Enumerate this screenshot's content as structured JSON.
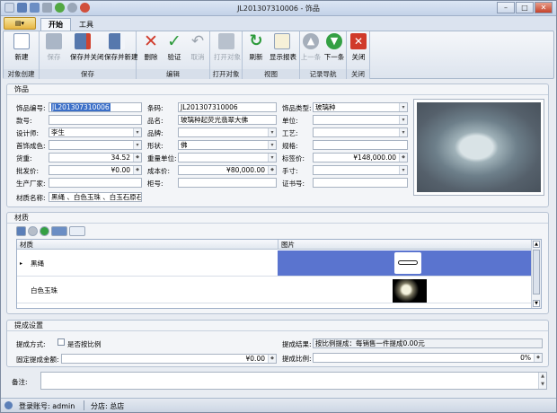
{
  "window": {
    "title": "JL201307310006 - 饰品"
  },
  "tabs": [
    {
      "label": "开始"
    },
    {
      "label": "工具"
    }
  ],
  "ribbon": {
    "groups": [
      {
        "label": "对象创建",
        "buttons": [
          {
            "label": "新建",
            "icon": "new-doc-icon"
          }
        ]
      },
      {
        "label": "保存",
        "buttons": [
          {
            "label": "保存",
            "icon": "save-icon"
          },
          {
            "label": "保存并关闭",
            "icon": "save-close-icon"
          },
          {
            "label": "保存并新建",
            "icon": "save-new-icon"
          }
        ]
      },
      {
        "label": "编辑",
        "buttons": [
          {
            "label": "删除",
            "icon": "delete-icon"
          },
          {
            "label": "验证",
            "icon": "check-icon"
          },
          {
            "label": "取消",
            "icon": "undo-icon"
          }
        ]
      },
      {
        "label": "打开对象",
        "buttons": [
          {
            "label": "打开对象",
            "icon": "open-object-icon"
          }
        ]
      },
      {
        "label": "视图",
        "buttons": [
          {
            "label": "刷新",
            "icon": "refresh-icon"
          },
          {
            "label": "显示报表",
            "icon": "report-icon"
          }
        ]
      },
      {
        "label": "记录导航",
        "buttons": [
          {
            "label": "上一条",
            "icon": "arrow-up-icon"
          },
          {
            "label": "下一条",
            "icon": "arrow-down-icon"
          }
        ]
      },
      {
        "label": "关闭",
        "buttons": [
          {
            "label": "关闭",
            "icon": "close-red-icon"
          }
        ]
      }
    ]
  },
  "jewelry": {
    "section_title": "饰品",
    "fields": {
      "item_no": {
        "label": "饰品编号:",
        "value": "JL201307310006"
      },
      "barcode": {
        "label": "条码:",
        "value": "JL201307310006"
      },
      "item_type": {
        "label": "饰品类型:",
        "value": "玻璃种"
      },
      "style_no": {
        "label": "款号:",
        "value": ""
      },
      "name": {
        "label": "品名:",
        "value": "玻璃种起荧光翡翠大佛"
      },
      "unit": {
        "label": "单位:",
        "value": ""
      },
      "designer": {
        "label": "设计师:",
        "value": "李生"
      },
      "brand": {
        "label": "品牌:",
        "value": ""
      },
      "craft": {
        "label": "工艺:",
        "value": ""
      },
      "jewelry_color": {
        "label": "首饰成色:",
        "value": ""
      },
      "shape": {
        "label": "形状:",
        "value": "佛"
      },
      "spec": {
        "label": "规格:",
        "value": ""
      },
      "weight": {
        "label": "货重:",
        "value": "34.52"
      },
      "weight_unit": {
        "label": "重量单位:",
        "value": ""
      },
      "tag_price": {
        "label": "标签价:",
        "value": "¥148,000.00"
      },
      "wholesale": {
        "label": "批发价:",
        "value": "¥0.00"
      },
      "cost": {
        "label": "成本价:",
        "value": "¥80,000.00"
      },
      "hand_size": {
        "label": "手寸:",
        "value": ""
      },
      "manufacturer": {
        "label": "生产厂家:",
        "value": ""
      },
      "cabinet": {
        "label": "柜号:",
        "value": ""
      },
      "cert_no": {
        "label": "证书号:",
        "value": ""
      },
      "material_name": {
        "label": "材质名称:",
        "value": "黑绳 、白色玉珠 、白玉石原石"
      }
    }
  },
  "materials": {
    "section_title": "材质",
    "columns": [
      "材质",
      "图片"
    ],
    "rows": [
      {
        "name": "黑绳"
      },
      {
        "name": "白色玉珠"
      }
    ]
  },
  "commission": {
    "section_title": "提成设置",
    "mode_label": "提成方式:",
    "ratio_check_label": "是否按比例",
    "fixed_label": "固定提成金额:",
    "fixed_value": "¥0.00",
    "result_label": "提成结果:",
    "result_value": "按比例提成：每销售一件提成0.00元",
    "ratio_label": "提成比例:",
    "ratio_value": "0%"
  },
  "remark": {
    "label": "备注:"
  },
  "status": {
    "login": "登录账号: admin",
    "store": "分店: 总店"
  },
  "colors": {
    "accent": "#3b6fc8",
    "ribbon_bg": "#dde4ee",
    "delete": "#d03a2a",
    "confirm": "#2c9a3a"
  }
}
